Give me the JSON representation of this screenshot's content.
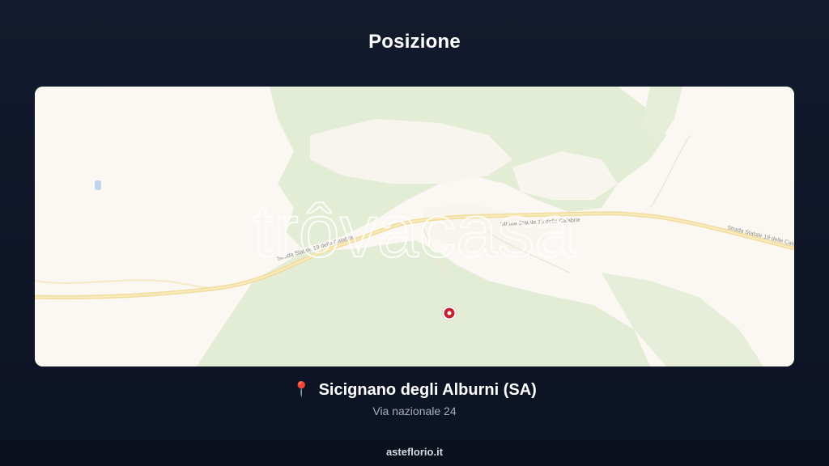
{
  "header": {
    "title": "Posizione"
  },
  "map": {
    "watermark": "trôvacasa",
    "road_labels": [
      "Strada Statale 19 delle Calabrie",
      "Strada Statale 19 delle Calabrie",
      "Strada Statale 19 delle Calabrie"
    ],
    "marker_icon": "location-marker-icon",
    "colors": {
      "land": "#fbf7f2",
      "forest": "#e3edd6",
      "road": "#f6e3a4",
      "marker": "#c8202f"
    }
  },
  "location": {
    "icon": "pin-emoji-icon",
    "pin_glyph": "📍",
    "name": "Sicignano degli Alburni (SA)",
    "address": "Via nazionale 24"
  },
  "footer": {
    "site": "asteflorio.it"
  }
}
